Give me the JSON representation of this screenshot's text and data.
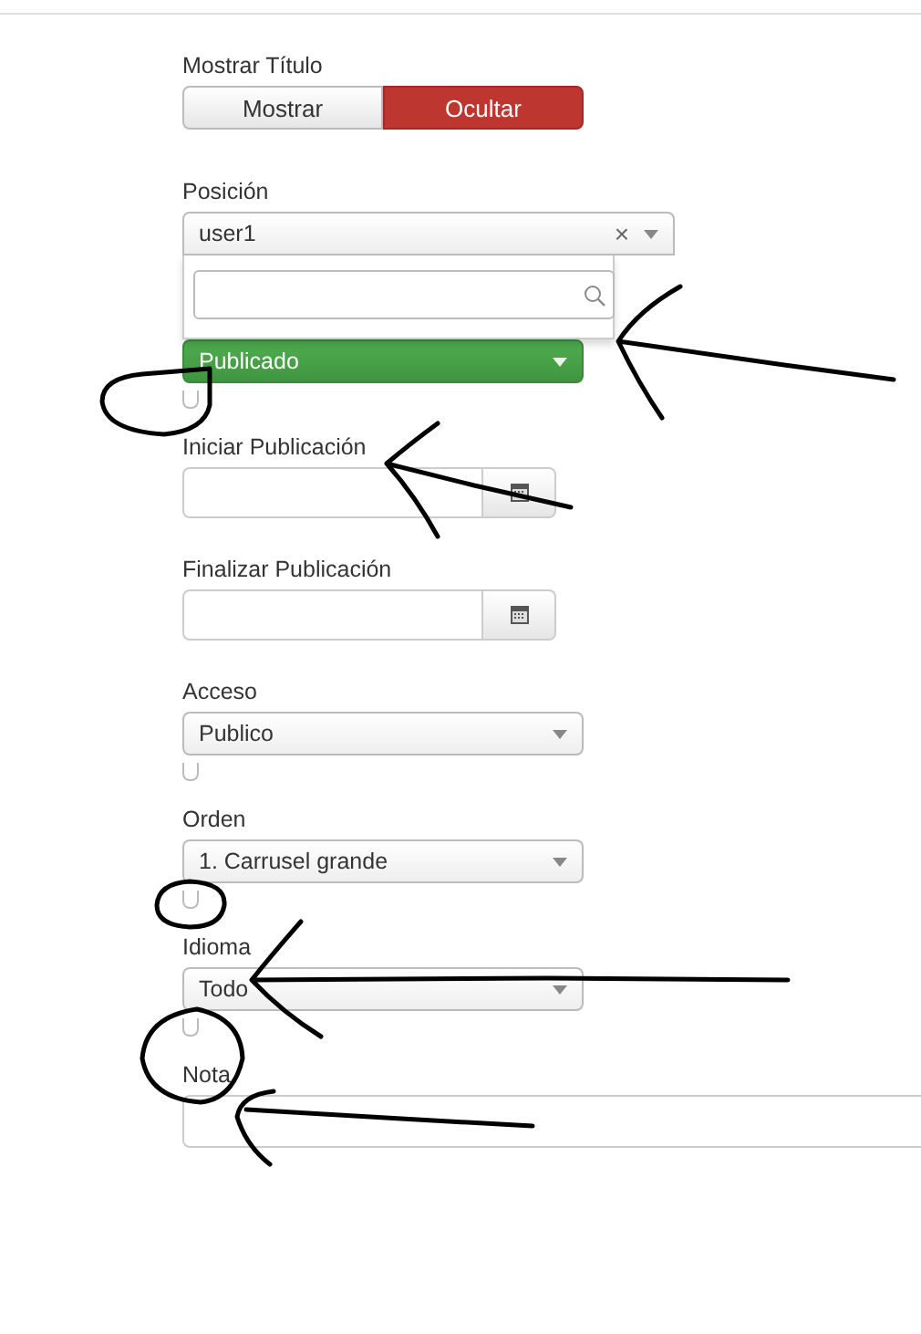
{
  "fields": [
    {
      "kind": "toggle",
      "label": "Mostrar Título",
      "options": [
        {
          "label": "Mostrar",
          "selected": false
        },
        {
          "label": "Ocultar",
          "selected": true
        }
      ]
    },
    {
      "kind": "search-select",
      "label": "Posición",
      "value": "user1",
      "clear": "×",
      "expanded": true
    },
    {
      "kind": "status-select",
      "value": "Publicado"
    },
    {
      "kind": "checkbox",
      "checked": false
    },
    {
      "kind": "date",
      "label": "Iniciar Publicación"
    },
    {
      "kind": "date",
      "label": "Finalizar Publicación"
    },
    {
      "kind": "select",
      "label": "Acceso",
      "value": "Publico"
    },
    {
      "kind": "checkbox",
      "checked": false
    },
    {
      "kind": "select",
      "label": "Orden",
      "value": "1. Carrusel grande"
    },
    {
      "kind": "checkbox",
      "checked": false
    },
    {
      "kind": "select",
      "label": "Idioma",
      "value": "Todo"
    },
    {
      "kind": "checkbox",
      "checked": false
    },
    {
      "kind": "text",
      "label": "Nota"
    }
  ]
}
